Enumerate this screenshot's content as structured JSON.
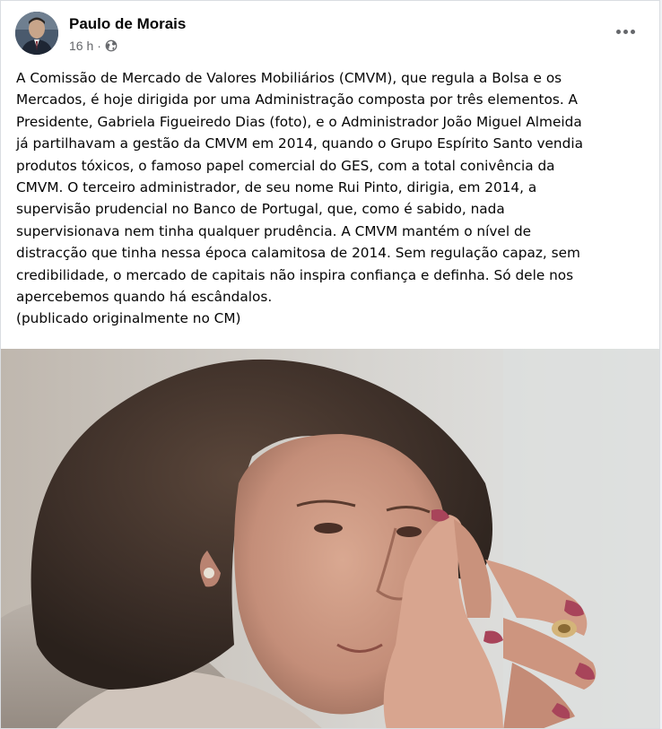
{
  "post": {
    "author": "Paulo de Morais",
    "timestamp": "16 h",
    "separator": "·",
    "audience_icon": "globe-icon",
    "more_icon": "more-options-icon",
    "body": "A Comissão de Mercado de Valores Mobiliários (CMVM), que regula a Bolsa e os\nMercados, é hoje dirigida por uma Administração composta por três elementos. A\nPresidente, Gabriela Figueiredo Dias (foto), e o Administrador João Miguel Almeida\njá partilhavam a gestão da CMVM em 2014, quando o Grupo Espírito Santo vendia\nprodutos tóxicos, o famoso papel comercial do GES, com a total conivência da\nCMVM. O terceiro administrador, de seu nome Rui Pinto, dirigia, em 2014, a\nsupervisão prudencial no Banco de Portugal, que, como é sabido, nada\nsupervisionava nem tinha qualquer prudência. A CMVM mantém o nível de\ndistracção que tinha nessa época calamitosa de 2014. Sem regulação capaz, sem\ncredibilidade, o mercado de capitais não inspira confiança e definha. Só dele nos\napercebemos quando há escândalos.\n(publicado originalmente no CM)"
  },
  "colors": {
    "card_bg": "#ffffff",
    "page_bg": "#f0f2f5",
    "text_primary": "#050505",
    "text_secondary": "#65676b"
  }
}
